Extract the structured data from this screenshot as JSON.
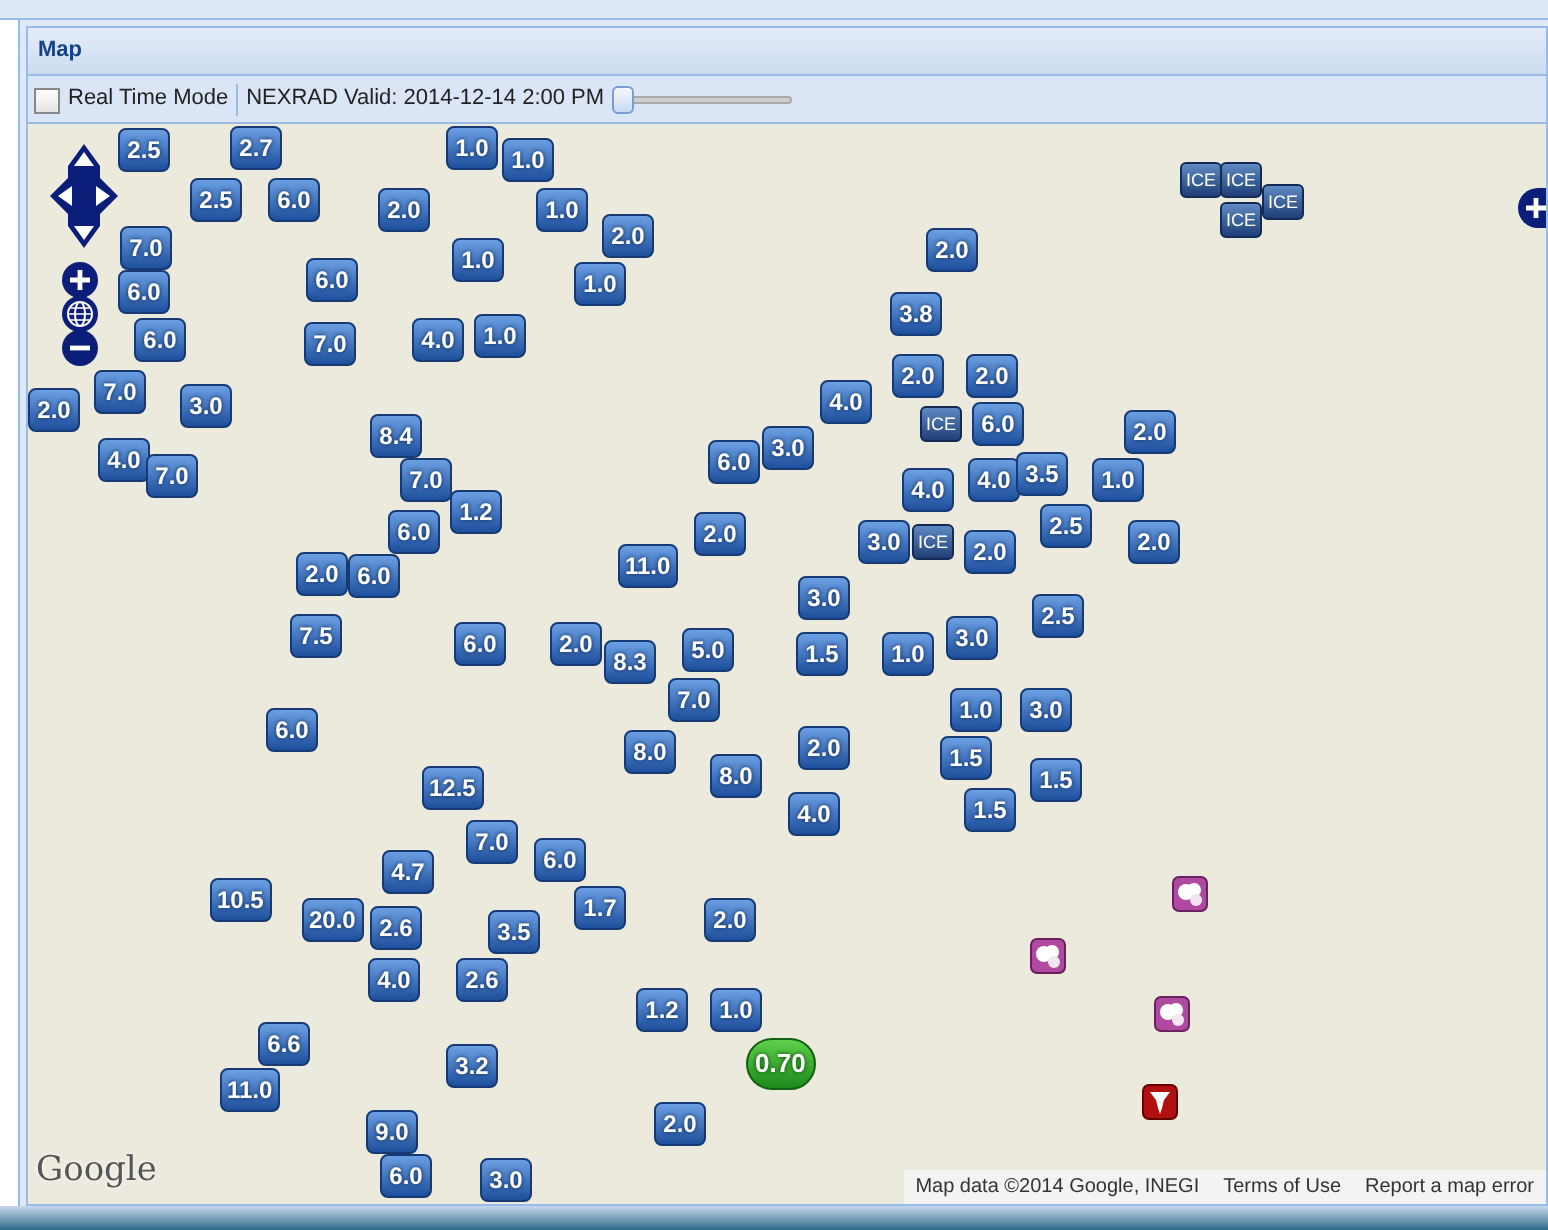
{
  "panel": {
    "title": "Map"
  },
  "toolbar": {
    "real_time_mode": {
      "label": "Real Time Mode",
      "checked": false
    },
    "radar_valid": "NEXRAD Valid: 2014-12-14 2:00 PM",
    "time_slider": {
      "level": 0
    }
  },
  "map": {
    "markers": [
      {
        "kind": "snow",
        "value": "2.5"
      },
      {
        "kind": "snow",
        "value": "2.7"
      },
      {
        "kind": "snow",
        "value": "1.0"
      },
      {
        "kind": "snow",
        "value": "1.0"
      },
      {
        "kind": "snow",
        "value": "2.5"
      },
      {
        "kind": "snow",
        "value": "6.0"
      },
      {
        "kind": "snow",
        "value": "2.0"
      },
      {
        "kind": "snow",
        "value": "1.0"
      },
      {
        "kind": "snow",
        "value": "2.0"
      },
      {
        "kind": "snow",
        "value": "7.0"
      },
      {
        "kind": "snow",
        "value": "6.0"
      },
      {
        "kind": "snow",
        "value": "6.0"
      },
      {
        "kind": "snow",
        "value": "6.0"
      },
      {
        "kind": "snow",
        "value": "1.0"
      },
      {
        "kind": "snow",
        "value": "1.0"
      },
      {
        "kind": "snow",
        "value": "7.0"
      },
      {
        "kind": "snow",
        "value": "4.0"
      },
      {
        "kind": "snow",
        "value": "1.0"
      },
      {
        "kind": "snow",
        "value": "7.0"
      },
      {
        "kind": "snow",
        "value": "2.0"
      },
      {
        "kind": "snow",
        "value": "3.0"
      },
      {
        "kind": "snow",
        "value": "4.0"
      },
      {
        "kind": "snow",
        "value": "7.0"
      },
      {
        "kind": "snow",
        "value": "8.4"
      },
      {
        "kind": "snow",
        "value": "7.0"
      },
      {
        "kind": "snow",
        "value": "1.2"
      },
      {
        "kind": "snow",
        "value": "6.0"
      },
      {
        "kind": "snow",
        "value": "2.0"
      },
      {
        "kind": "snow",
        "value": "6.0"
      },
      {
        "kind": "snow",
        "value": "3.8"
      },
      {
        "kind": "snow",
        "value": "2.0"
      },
      {
        "kind": "snow",
        "value": "4.0"
      },
      {
        "kind": "snow",
        "value": "2.0"
      },
      {
        "kind": "snow",
        "value": "2.0"
      },
      {
        "kind": "snow",
        "value": "6.0"
      },
      {
        "kind": "snow",
        "value": "2.0"
      },
      {
        "kind": "snow",
        "value": "6.0"
      },
      {
        "kind": "snow",
        "value": "3.0"
      },
      {
        "kind": "snow",
        "value": "4.0"
      },
      {
        "kind": "snow",
        "value": "4.0"
      },
      {
        "kind": "snow",
        "value": "3.5"
      },
      {
        "kind": "snow",
        "value": "1.0"
      },
      {
        "kind": "snow",
        "value": "2.0"
      },
      {
        "kind": "snow",
        "value": "3.0"
      },
      {
        "kind": "snow",
        "value": "2.0"
      },
      {
        "kind": "snow",
        "value": "2.5"
      },
      {
        "kind": "snow",
        "value": "2.0"
      },
      {
        "kind": "snow",
        "value": "11.0"
      },
      {
        "kind": "snow",
        "value": "3.0"
      },
      {
        "kind": "snow",
        "value": "1.5"
      },
      {
        "kind": "snow",
        "value": "3.0"
      },
      {
        "kind": "snow",
        "value": "1.0"
      },
      {
        "kind": "snow",
        "value": "2.5"
      },
      {
        "kind": "snow",
        "value": "5.0"
      },
      {
        "kind": "snow",
        "value": "7.0"
      },
      {
        "kind": "snow",
        "value": "8.3"
      },
      {
        "kind": "snow",
        "value": "7.5"
      },
      {
        "kind": "snow",
        "value": "6.0"
      },
      {
        "kind": "snow",
        "value": "2.0"
      },
      {
        "kind": "snow",
        "value": "1.0"
      },
      {
        "kind": "snow",
        "value": "3.0"
      },
      {
        "kind": "snow",
        "value": "1.5"
      },
      {
        "kind": "snow",
        "value": "1.5"
      },
      {
        "kind": "snow",
        "value": "8.0"
      },
      {
        "kind": "snow",
        "value": "2.0"
      },
      {
        "kind": "snow",
        "value": "8.0"
      },
      {
        "kind": "snow",
        "value": "4.0"
      },
      {
        "kind": "snow",
        "value": "1.5"
      },
      {
        "kind": "snow",
        "value": "6.0"
      },
      {
        "kind": "snow",
        "value": "12.5"
      },
      {
        "kind": "snow",
        "value": "7.0"
      },
      {
        "kind": "snow",
        "value": "4.7"
      },
      {
        "kind": "snow",
        "value": "6.0"
      },
      {
        "kind": "snow",
        "value": "1.7"
      },
      {
        "kind": "snow",
        "value": "10.5"
      },
      {
        "kind": "snow",
        "value": "20.0"
      },
      {
        "kind": "snow",
        "value": "2.6"
      },
      {
        "kind": "snow",
        "value": "3.5"
      },
      {
        "kind": "snow",
        "value": "4.0"
      },
      {
        "kind": "snow",
        "value": "2.6"
      },
      {
        "kind": "snow",
        "value": "6.6"
      },
      {
        "kind": "snow",
        "value": "11.0"
      },
      {
        "kind": "snow",
        "value": "3.2"
      },
      {
        "kind": "snow",
        "value": "9.0"
      },
      {
        "kind": "snow",
        "value": "6.0"
      },
      {
        "kind": "snow",
        "value": "3.0"
      },
      {
        "kind": "snow",
        "value": "2.0"
      },
      {
        "kind": "snow",
        "value": "1.2"
      },
      {
        "kind": "snow",
        "value": "1.0"
      },
      {
        "kind": "snow",
        "value": "2.0"
      },
      {
        "kind": "ice",
        "value": "ICE"
      },
      {
        "kind": "ice",
        "value": "ICE"
      },
      {
        "kind": "ice",
        "value": "ICE"
      },
      {
        "kind": "ice",
        "value": "ICE"
      },
      {
        "kind": "ice",
        "value": "ICE"
      },
      {
        "kind": "ice",
        "value": "ICE"
      },
      {
        "kind": "rain",
        "value": "0.70"
      },
      {
        "kind": "report"
      },
      {
        "kind": "report"
      },
      {
        "kind": "report"
      },
      {
        "kind": "tornado"
      }
    ],
    "logo": "Google",
    "attribution": [
      "Map data ©2014 Google, INEGI",
      "Terms of Use",
      "Report a map error"
    ]
  }
}
